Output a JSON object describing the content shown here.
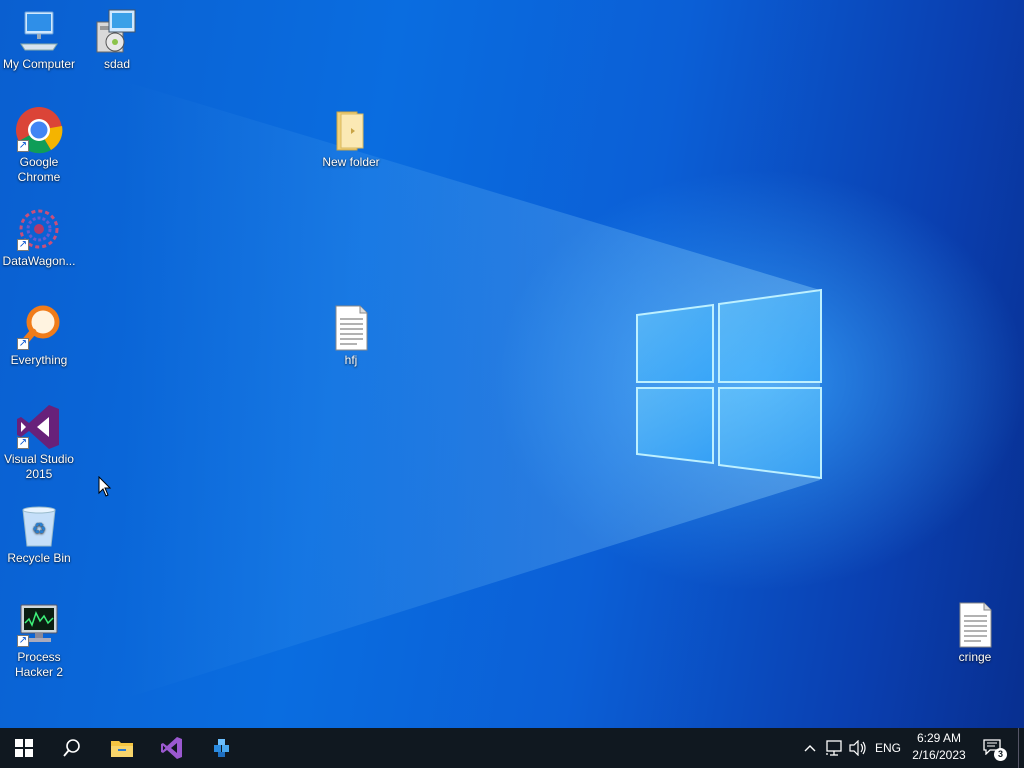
{
  "desktop": {
    "icons": [
      {
        "name": "my-computer",
        "label": "My Computer"
      },
      {
        "name": "sdad",
        "label": "sdad"
      },
      {
        "name": "google-chrome",
        "label": "Google Chrome"
      },
      {
        "name": "new-folder",
        "label": "New folder"
      },
      {
        "name": "datawagon",
        "label": "DataWagon..."
      },
      {
        "name": "everything",
        "label": "Everything"
      },
      {
        "name": "hfj",
        "label": "hfj"
      },
      {
        "name": "visual-studio-2015",
        "label": "Visual Studio 2015"
      },
      {
        "name": "recycle-bin",
        "label": "Recycle Bin"
      },
      {
        "name": "process-hacker-2",
        "label": "Process Hacker 2"
      },
      {
        "name": "cringe",
        "label": "cringe"
      }
    ]
  },
  "taskbar": {
    "pinned": [
      "start-icon",
      "search-icon",
      "file-explorer-icon",
      "visual-studio-icon",
      "datawagon-icon"
    ],
    "tray": {
      "language": "ENG",
      "time": "6:29 AM",
      "date": "2/16/2023",
      "notification_count": "3"
    }
  },
  "colors": {
    "taskbar": "#101820",
    "desktop_accent": "#0a6de0"
  }
}
